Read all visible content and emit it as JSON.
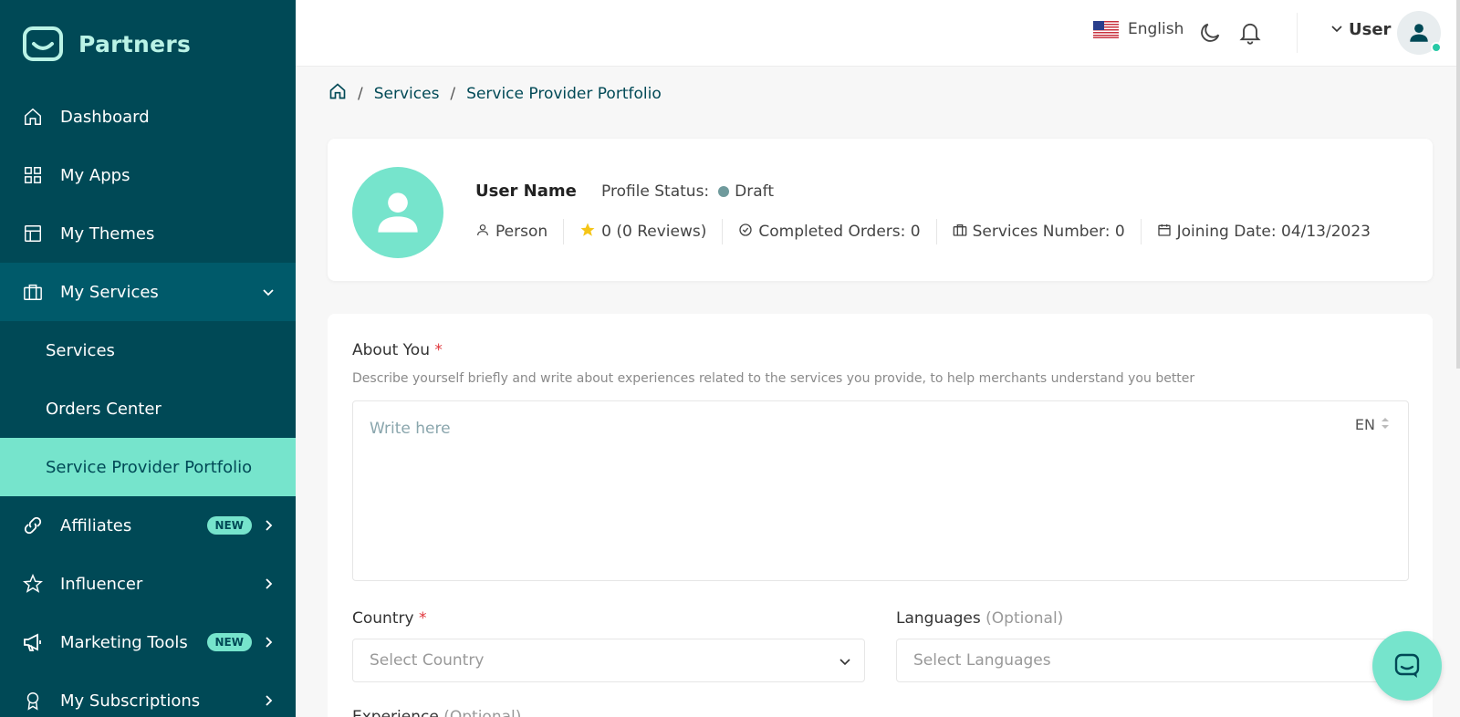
{
  "brand": {
    "name": "Partners"
  },
  "sidebar": {
    "items": [
      {
        "label": "Dashboard",
        "icon": "home-icon"
      },
      {
        "label": "My Apps",
        "icon": "grid-icon"
      },
      {
        "label": "My Themes",
        "icon": "layout-icon"
      },
      {
        "label": "My Services",
        "icon": "briefcase-icon",
        "expanded": true
      },
      {
        "label": "Affiliates",
        "icon": "link-icon",
        "badge": "NEW"
      },
      {
        "label": "Influencer",
        "icon": "star-icon"
      },
      {
        "label": "Marketing Tools",
        "icon": "megaphone-icon",
        "badge": "NEW"
      },
      {
        "label": "My Subscriptions",
        "icon": "award-icon"
      }
    ],
    "sub_items": [
      {
        "label": "Services"
      },
      {
        "label": "Orders Center"
      },
      {
        "label": "Service Provider Portfolio",
        "active": true
      }
    ]
  },
  "topbar": {
    "language": "English",
    "user": "User"
  },
  "breadcrumb": [
    "Services",
    "Service Provider Portfolio"
  ],
  "profile": {
    "name": "User Name",
    "status_label": "Profile Status:",
    "status_value": "Draft",
    "type": "Person",
    "rating": "0 (0 Reviews)",
    "completed_orders": "Completed Orders: 0",
    "services_number": "Services Number: 0",
    "joining_date": "Joining Date: 04/13/2023"
  },
  "form": {
    "about_label": "About You",
    "required_mark": "*",
    "about_helper": "Describe yourself briefly and write about experiences related to the services you provide, to help merchants understand you better",
    "about_placeholder": "Write here",
    "about_lang": "EN",
    "country_label": "Country",
    "country_placeholder": "Select Country",
    "languages_label": "Languages",
    "optional_text": "(Optional)",
    "languages_placeholder": "Select Languages",
    "experience_label": "Experience"
  },
  "colors": {
    "sidebar_bg": "#004956",
    "accent": "#76e4cc",
    "required": "#e0353b"
  }
}
